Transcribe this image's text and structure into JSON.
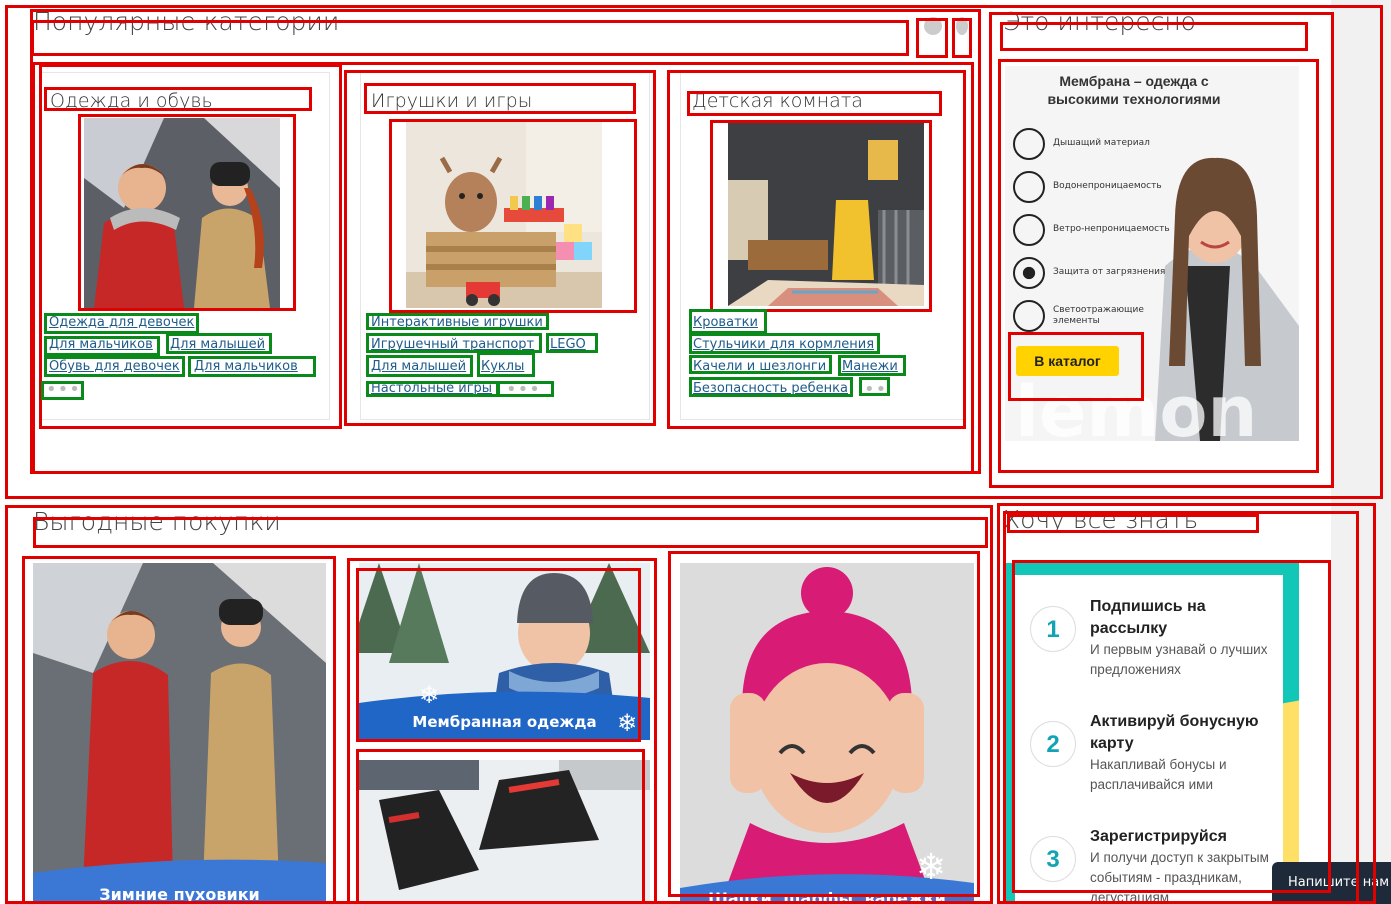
{
  "sections": {
    "popular_title": "Популярные категории",
    "interesting_title": "Это интересно",
    "deals_title": "Выгодные покупки",
    "know_title": "Хочу все знать"
  },
  "categories": [
    {
      "title": "Одежда и обувь",
      "links": [
        "Одежда для девочек",
        "Для мальчиков",
        "Для малышей",
        "Обувь для девочек",
        "Для мальчиков"
      ],
      "more": "•••"
    },
    {
      "title": "Игрушки и игры",
      "links": [
        "Интерактивные игрушки",
        "Игрушечный транспорт",
        "LEGO",
        "Для малышей",
        "Куклы",
        "Настольные игры"
      ],
      "more": "•••"
    },
    {
      "title": "Детская комната",
      "links": [
        "Кроватки",
        "Стульчики для кормления",
        "Качели и шезлонги",
        "Манежи",
        "Безопасность ребенка"
      ],
      "more": "••"
    }
  ],
  "promo": {
    "heading": "Мембрана – одежда с высокими технологиями",
    "features": [
      "Дышащий материал",
      "Водонепроницаемость",
      "Ветро-непроницаемость",
      "Защита от загрязнения",
      "Светоотражающие элементы"
    ],
    "button": "В каталог",
    "brand": "lemon"
  },
  "deals": {
    "banner1_text": "Зимние пуховики",
    "membrane_text": "Мембранная одежда",
    "banner3_text": "Шапки, шарфы, варежки"
  },
  "steps": [
    {
      "num": "1",
      "title": "Подпишись на рассылку",
      "desc": "И первым узнавай о лучших предложениях"
    },
    {
      "num": "2",
      "title": "Активируй бонусную карту",
      "desc": "Накапливай бонусы и расплачивайся ими"
    },
    {
      "num": "3",
      "title": "Зарегистрируйся",
      "desc": "И получи доступ к закрытым событиям - праздникам, дегустациям"
    }
  ],
  "chat": {
    "label": "Напишите нам"
  },
  "colors": {
    "annotation_red": "#e00000",
    "annotation_green": "#0a8a1a",
    "link": "#1f5c8a",
    "accent_yellow": "#ffd200",
    "teal": "#12a3b5",
    "hat_pink": "#d81b74"
  }
}
